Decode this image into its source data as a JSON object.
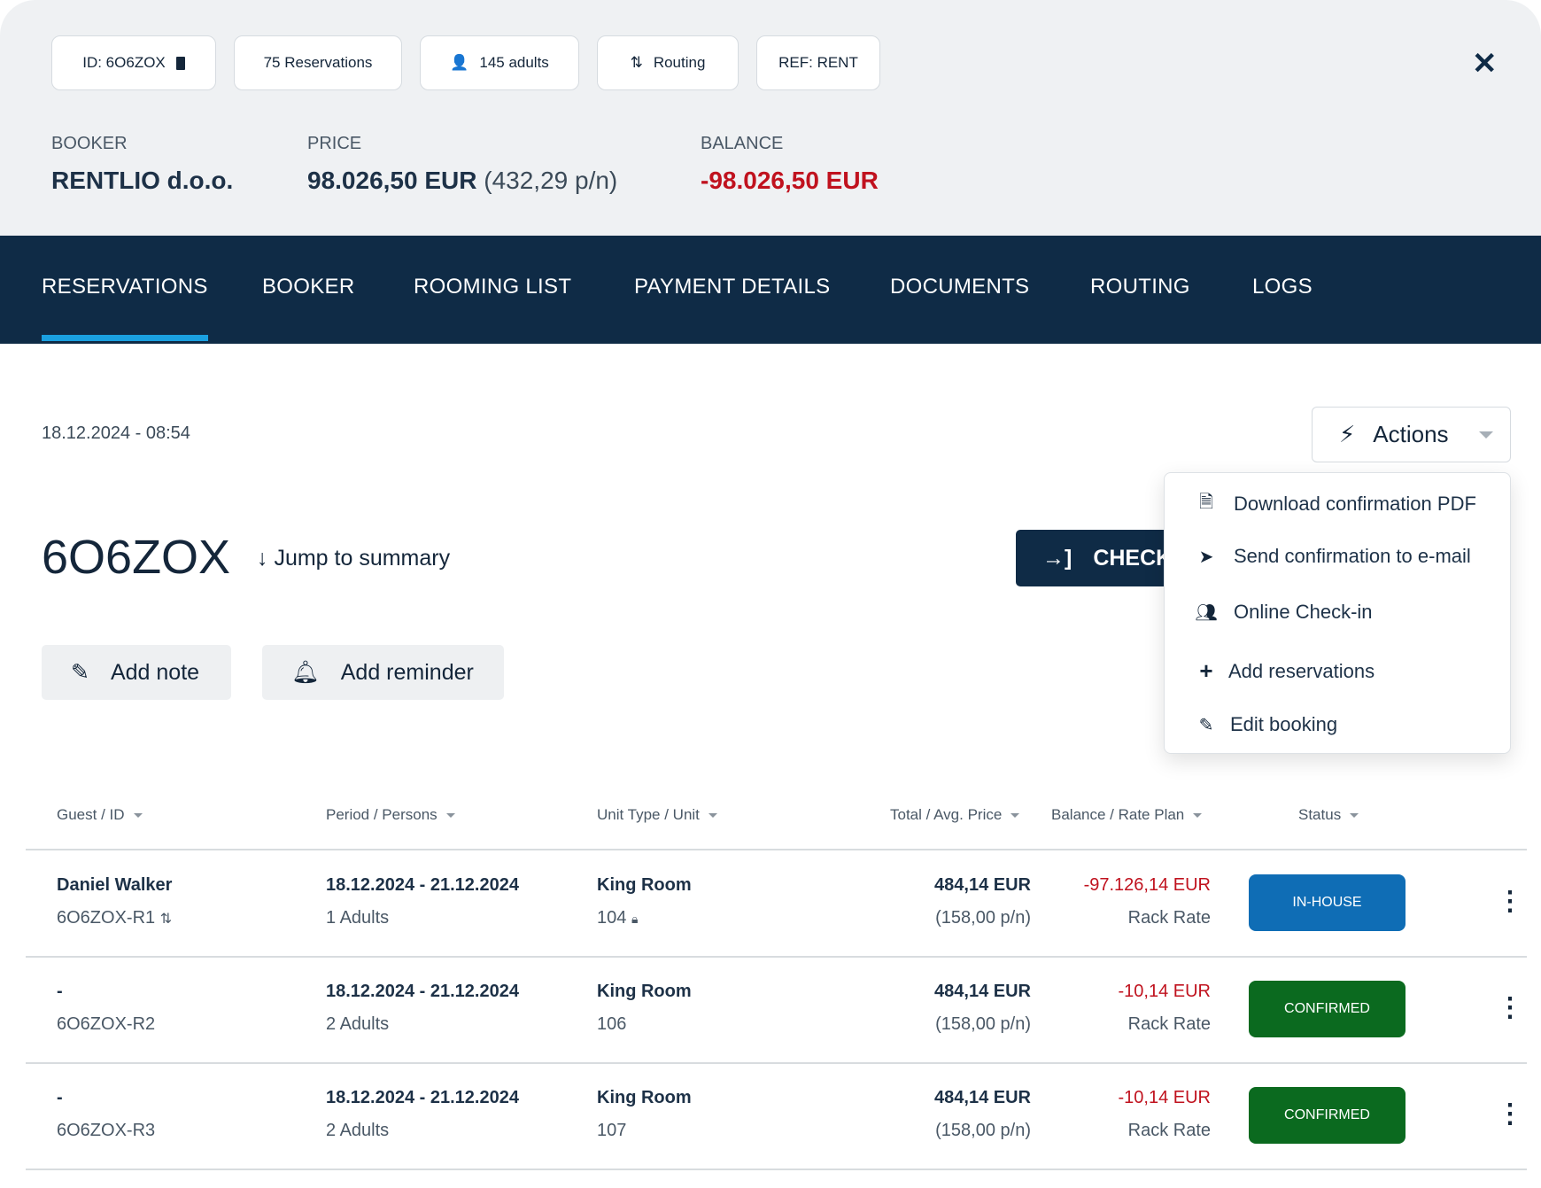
{
  "header": {
    "chips": [
      {
        "label": "ID: 6O6ZOX",
        "icon": "copy-icon"
      },
      {
        "label": "75 Reservations"
      },
      {
        "label": "145 adults",
        "icon": "person-icon"
      },
      {
        "label": "Routing",
        "icon": "routing-icon"
      },
      {
        "label": "REF: RENT"
      }
    ],
    "booker_label": "BOOKER",
    "booker_value": "RENTLIO d.o.o.",
    "price_label": "PRICE",
    "price_value": "98.026,50 EUR",
    "price_per_night": "(432,29 p/n)",
    "balance_label": "BALANCE",
    "balance_value": "-98.026,50 EUR"
  },
  "tabs": [
    "RESERVATIONS",
    "BOOKER",
    "ROOMING LIST",
    "PAYMENT DETAILS",
    "DOCUMENTS",
    "ROUTING",
    "LOGS"
  ],
  "active_tab": "RESERVATIONS",
  "main": {
    "date": "18.12.2024 - 08:54",
    "actions_label": "Actions",
    "title": "6O6ZOX",
    "jump_label": "Jump to summary",
    "checkin_label": "CHECK-",
    "add_note": "Add note",
    "add_reminder": "Add reminder"
  },
  "actions_menu": [
    {
      "label": "Download confirmation PDF",
      "icon": "document-icon"
    },
    {
      "label": "Send confirmation to e-mail",
      "icon": "send-icon"
    },
    {
      "label": "Online Check-in",
      "icon": "users-icon"
    },
    {
      "label": "Add reservations",
      "icon": "plus-icon"
    },
    {
      "label": "Edit booking",
      "icon": "pencil-icon"
    }
  ],
  "table": {
    "columns": [
      "Guest / ID",
      "Period / Persons",
      "Unit Type / Unit",
      "Total / Avg. Price",
      "Balance / Rate Plan",
      "Status"
    ],
    "rows": [
      {
        "guest": "Daniel Walker",
        "id": "6O6ZOX-R1",
        "period": "18.12.2024 - 21.12.2024",
        "persons": "1 Adults",
        "unit_type": "King Room",
        "unit": "104",
        "total": "484,14 EUR",
        "avg": "(158,00 p/n)",
        "balance": "-97.126,14 EUR",
        "rate_plan": "Rack Rate",
        "status": "IN-HOUSE",
        "status_color": "#0f6db5"
      },
      {
        "guest": "-",
        "id": "6O6ZOX-R2",
        "period": "18.12.2024 - 21.12.2024",
        "persons": "2 Adults",
        "unit_type": "King Room",
        "unit": "106",
        "total": "484,14 EUR",
        "avg": "(158,00 p/n)",
        "balance": "-10,14 EUR",
        "rate_plan": "Rack Rate",
        "status": "CONFIRMED",
        "status_color": "#0b6a1f"
      },
      {
        "guest": "-",
        "id": "6O6ZOX-R3",
        "period": "18.12.2024 - 21.12.2024",
        "persons": "2 Adults",
        "unit_type": "King Room",
        "unit": "107",
        "total": "484,14 EUR",
        "avg": "(158,00 p/n)",
        "balance": "-10,14 EUR",
        "rate_plan": "Rack Rate",
        "status": "CONFIRMED",
        "status_color": "#0b6a1f"
      }
    ]
  },
  "colors": {
    "navy": "#0f2b46",
    "accent": "#1aa0e0",
    "negative": "#c0121e"
  }
}
